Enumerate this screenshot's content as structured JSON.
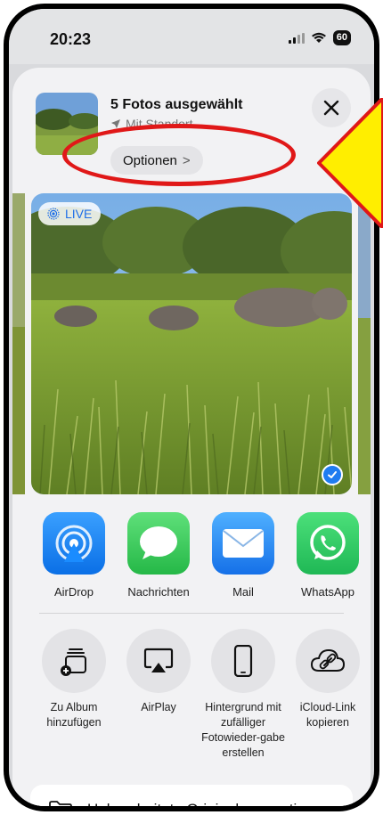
{
  "status_bar": {
    "time": "20:23",
    "battery": "60"
  },
  "share_header": {
    "title": "5 Fotos ausgewählt",
    "subtitle": "Mit Standort",
    "options_label": "Optionen",
    "options_chevron": ">"
  },
  "photo": {
    "live_label": "LIVE",
    "selected": true
  },
  "apps": [
    {
      "label": "AirDrop",
      "icon": "airdrop-icon",
      "color": "#1a8cff"
    },
    {
      "label": "Nachrichten",
      "icon": "messages-icon",
      "color": "#34c759"
    },
    {
      "label": "Mail",
      "icon": "mail-icon",
      "color": "#2a8cf5"
    },
    {
      "label": "WhatsApp",
      "icon": "whatsapp-icon",
      "color": "#25d366"
    }
  ],
  "actions": [
    {
      "label": "Zu Album hinzufügen",
      "icon": "add-to-album-icon"
    },
    {
      "label": "AirPlay",
      "icon": "airplay-icon"
    },
    {
      "label": "Hintergrund mit zufälliger Fotowieder-gabe erstellen",
      "icon": "phone-wallpaper-icon"
    },
    {
      "label": "iCloud-Link kopieren",
      "icon": "icloud-link-icon"
    }
  ],
  "export": {
    "label": "Unbearbeitete Originale exportieren",
    "icon": "folder-icon"
  },
  "colors": {
    "annotation_red": "#e01818",
    "annotation_yellow": "#ffee00",
    "accent_blue": "#1f7cf0"
  }
}
